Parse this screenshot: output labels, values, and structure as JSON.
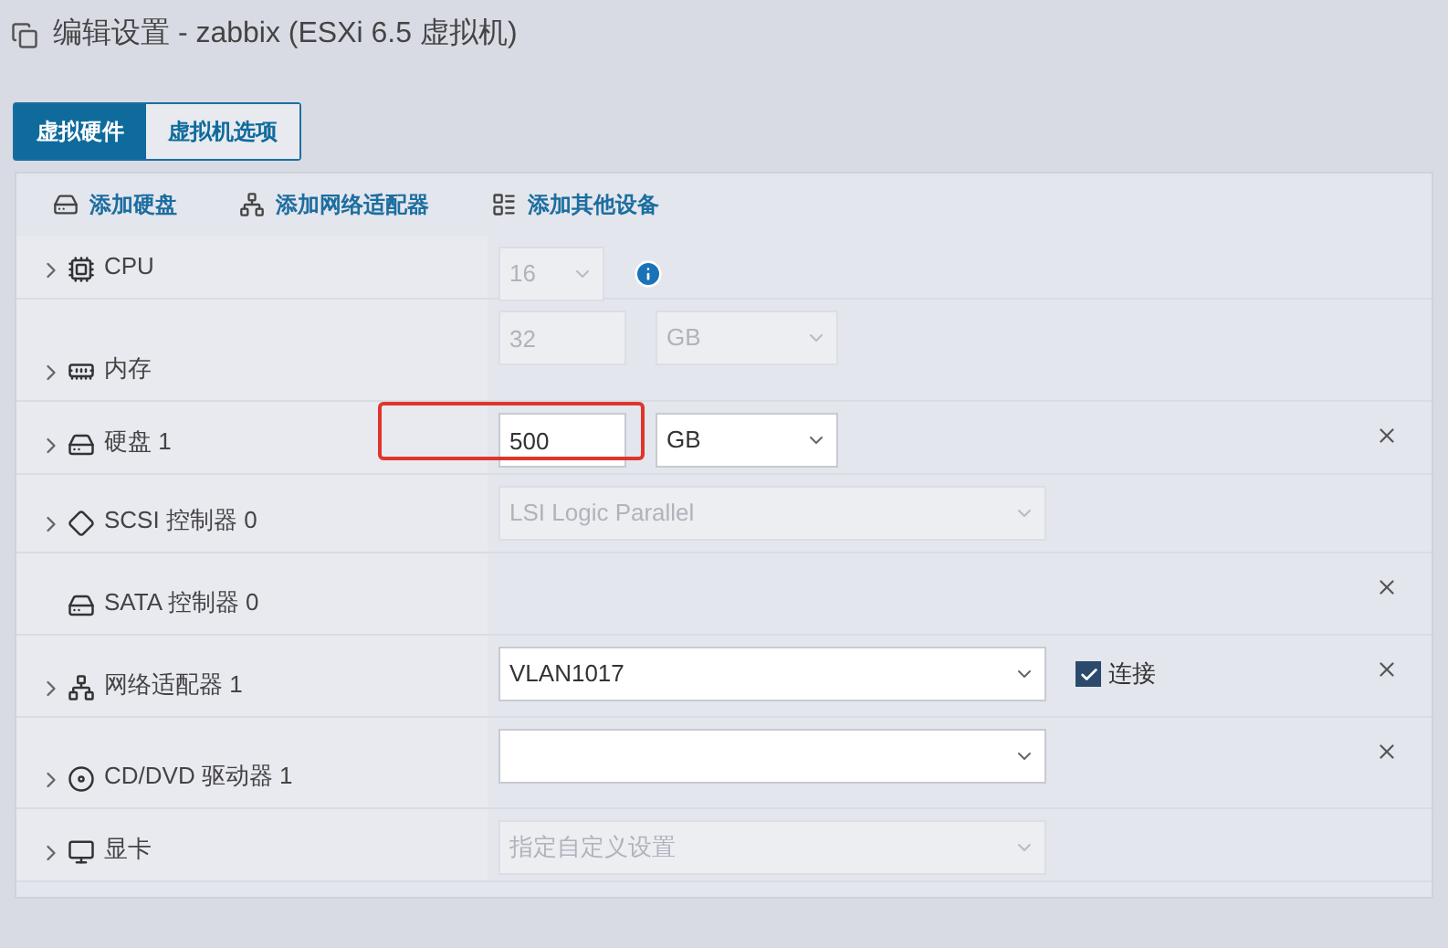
{
  "window": {
    "title": "编辑设置 - zabbix (ESXi 6.5 虚拟机)"
  },
  "tabs": [
    {
      "label": "虚拟硬件",
      "selected": true
    },
    {
      "label": "虚拟机选项",
      "selected": false
    }
  ],
  "toolbar": [
    {
      "label": "添加硬盘"
    },
    {
      "label": "添加网络适配器"
    },
    {
      "label": "添加其他设备"
    }
  ],
  "rows": [
    {
      "label": "CPU",
      "expandable": true,
      "controls": [
        {
          "kind": "select",
          "value": "16",
          "disabled": true
        },
        {
          "kind": "info"
        }
      ]
    },
    {
      "label": "内存",
      "expandable": true,
      "controls": [
        {
          "kind": "input",
          "value": "32",
          "disabled": true
        },
        {
          "kind": "select",
          "value": "GB",
          "disabled": true
        }
      ]
    },
    {
      "label": "硬盘 1",
      "expandable": true,
      "highlighted": true,
      "removable": true,
      "controls": [
        {
          "kind": "input",
          "value": "500",
          "disabled": false
        },
        {
          "kind": "select",
          "value": "GB",
          "disabled": false
        }
      ]
    },
    {
      "label": "SCSI 控制器 0",
      "expandable": true,
      "controls": [
        {
          "kind": "select",
          "value": "LSI Logic Parallel",
          "disabled": true
        }
      ]
    },
    {
      "label": "SATA 控制器 0",
      "expandable": false,
      "removable": true,
      "controls": []
    },
    {
      "label": "网络适配器 1",
      "expandable": true,
      "removable": true,
      "controls": [
        {
          "kind": "select",
          "value": "VLAN1017",
          "disabled": false
        },
        {
          "kind": "checkbox",
          "label": "连接",
          "checked": true
        }
      ]
    },
    {
      "label": "CD/DVD 驱动器 1",
      "expandable": true,
      "removable": true,
      "controls": [
        {
          "kind": "select",
          "disabled": false
        }
      ]
    },
    {
      "label": "显卡",
      "expandable": true,
      "controls": [
        {
          "kind": "select",
          "value": "指定自定义设置",
          "disabled": true
        }
      ]
    }
  ]
}
